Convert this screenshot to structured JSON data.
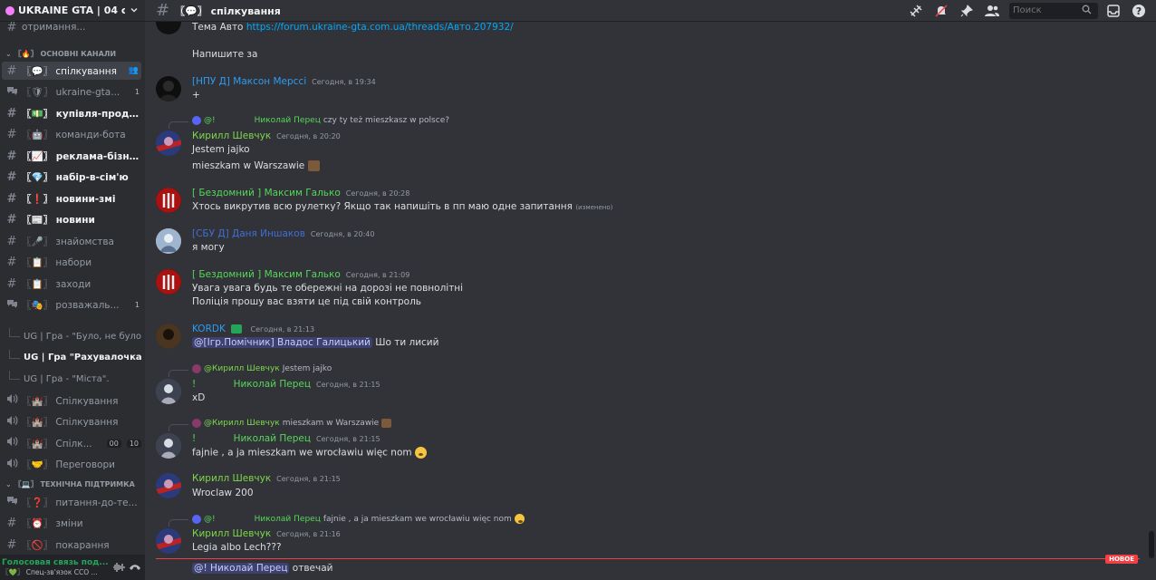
{
  "server": {
    "name": "UKRAINE GTA | 04 се..."
  },
  "sidebar": {
    "top_partial": "отримання...",
    "category_main": "〖🔥〗 ОСНОВНІ КАНАЛИ",
    "channels": [
      {
        "icon": "#",
        "name": "〖💬〗 спілкування",
        "active": true,
        "unread": false,
        "badge": ""
      },
      {
        "icon": "forum",
        "name": "〖🛡〗 ukraine-gta...",
        "active": false,
        "unread": false,
        "badge": "1"
      },
      {
        "icon": "#",
        "name": "〖💵〗 купівля-продаж...",
        "active": false,
        "unread": true,
        "badge": ""
      },
      {
        "icon": "#",
        "name": "〖🤖〗 команди-бота",
        "active": false,
        "unread": false,
        "badge": ""
      },
      {
        "icon": "#",
        "name": "〖📈〗 реклама-бізнесу",
        "active": false,
        "unread": true,
        "badge": ""
      },
      {
        "icon": "#",
        "name": "〖💎〗 набір-в-сім'ю",
        "active": false,
        "unread": true,
        "badge": ""
      },
      {
        "icon": "#",
        "name": "〖❗〗 новини-змі",
        "active": false,
        "unread": true,
        "badge": ""
      },
      {
        "icon": "#",
        "name": "〖📰〗 новини",
        "active": false,
        "unread": true,
        "badge": ""
      },
      {
        "icon": "#",
        "name": "〖🎤〗 знайомства",
        "active": false,
        "unread": false,
        "badge": ""
      },
      {
        "icon": "#",
        "name": "〖📋〗 набори",
        "active": false,
        "unread": false,
        "badge": ""
      },
      {
        "icon": "#",
        "name": "〖📋〗 заходи",
        "active": false,
        "unread": false,
        "badge": ""
      },
      {
        "icon": "forum",
        "name": "〖🎭〗 розважаль...",
        "active": false,
        "unread": false,
        "badge": "1"
      }
    ],
    "threads": [
      {
        "name": "UG | Гра - \"Було, не було\"...",
        "bright": false
      },
      {
        "name": "UG | Гра \"Рахувалочка\".",
        "bright": true
      },
      {
        "name": "UG | Гра - \"Міста\".",
        "bright": false
      }
    ],
    "voice_channels": [
      {
        "name": "〖🏰〗 Спілкування",
        "pill1": "",
        "pill2": ""
      },
      {
        "name": "〖🏰〗 Спілкування",
        "pill1": "",
        "pill2": ""
      },
      {
        "name": "〖🏰〗 Спілк...",
        "pill1": "00",
        "pill2": "10"
      },
      {
        "name": "〖🤝〗 Переговори",
        "pill1": "",
        "pill2": ""
      }
    ],
    "category_support": "〖💻〗 ТЕХНІЧНА ПІДТРИМКА",
    "support_channels": [
      {
        "icon": "forum",
        "name": "〖❓〗 питання-до-те..."
      },
      {
        "icon": "#",
        "name": "〖⏰〗 зміни"
      },
      {
        "icon": "#",
        "name": "〖🚫〗 покарання"
      }
    ],
    "voice_panel": {
      "status": "Голосовая связь под...",
      "channel": "〖💚〗 Спец-зв'язок ССО ..."
    }
  },
  "header": {
    "channel": "〖💬〗 спілкування",
    "search_placeholder": "Поиск"
  },
  "messages": {
    "m0": {
      "line1_prefix": "Тема Авто",
      "line1_link": "https://forum.ukraine-gta.com.ua/threads/Авто.207932/",
      "line2": "Напишите за"
    },
    "m1": {
      "author": "[НПУ Д] Максон Мерссі",
      "time": "Сегодня, в 19:34",
      "text": "+"
    },
    "m2": {
      "reply_author": "@!",
      "reply_name": "Николай Перец",
      "reply_text": "czy ty też mieszkasz w polsce?",
      "author": "Кирилл Шевчук",
      "time": "Сегодня, в 20:20",
      "line1": "Jestem jajko",
      "line2": "mieszkam w Warszawie"
    },
    "m3": {
      "author": "[ Бездомний ] Максим Галько",
      "time": "Сегодня, в 20:28",
      "text": "Хтось викрутив всю рулетку? Якщо так напишіть в пп маю одне запитання",
      "edited": "(изменено)"
    },
    "m4": {
      "author": "[СБУ Д] Даня Иншаков",
      "time": "Сегодня, в 20:40",
      "text": "я могу"
    },
    "m5": {
      "author": "[ Бездомний ] Максим Галько",
      "time": "Сегодня, в 21:09",
      "line1": "Увага увага будь те обережні на дорозі не повнолітні",
      "line2": "Поліція прошу вас взяти це під свій контроль"
    },
    "m6": {
      "author": "KORDK",
      "time": "Сегодня, в 21:13",
      "mention": "@[Ігр.Помічник] Владос Галицький",
      "text": " Шо ти лисий"
    },
    "m7": {
      "reply_author": "@Кирилл Шевчук",
      "reply_text": "Jestem jajko",
      "author_prefix": "!",
      "author": "Николай Перец",
      "time": "Сегодня, в 21:15",
      "text": "xD"
    },
    "m8": {
      "reply_author": "@Кирилл Шевчук",
      "reply_text": "mieszkam w Warszawie",
      "author_prefix": "!",
      "author": "Николай Перец",
      "time": "Сегодня, в 21:15",
      "text": "fajnie , a ja mieszkam we wrocławiu więc nom"
    },
    "m9": {
      "author": "Кирилл Шевчук",
      "time": "Сегодня, в 21:15",
      "text": "Wroclaw 200"
    },
    "m10": {
      "reply_author": "@!",
      "reply_name": "Николай Перец",
      "reply_text": "fajnie , a ja mieszkam we wrocławiu więc nom",
      "author": "Кирилл Шевчук",
      "time": "Сегодня, в 21:16",
      "text": "Legia albo Lech???"
    },
    "new_label": "НОВОЕ",
    "composer": {
      "mention": "@!              Николай Перец",
      "text": " отвечай"
    }
  },
  "colors": {
    "accent": "#5865f2",
    "green_name": "#57d65a",
    "lime_name": "#7dd94a",
    "blue_name": "#2e9cf2",
    "new_red": "#f23f43"
  }
}
